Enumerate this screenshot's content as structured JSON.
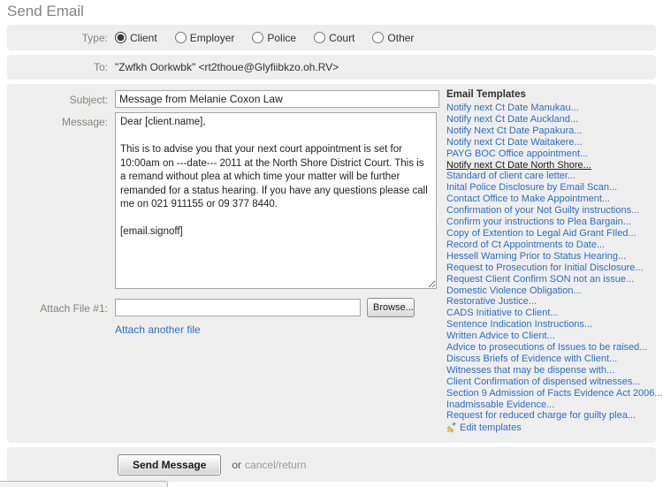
{
  "page": {
    "title": "Send Email"
  },
  "type_row": {
    "label": "Type:",
    "options": [
      {
        "label": "Client",
        "selected": true
      },
      {
        "label": "Employer",
        "selected": false
      },
      {
        "label": "Police",
        "selected": false
      },
      {
        "label": "Court",
        "selected": false
      },
      {
        "label": "Other",
        "selected": false
      }
    ]
  },
  "to_row": {
    "label": "To:",
    "value": "\"Zwfkh Oorkwbk\" <rt2thoue@Glyfiibkzo.oh.RV>"
  },
  "subject_row": {
    "label": "Subject:",
    "value": "Message from Melanie Coxon Law"
  },
  "message_row": {
    "label": "Message:",
    "value": "Dear [client.name],\n\nThis is to advise you that your next court appointment is set for 10:00am on ---date--- 2011 at the North Shore District Court. This is a remand without plea at which time your matter will be further remanded for a status hearing. If you have any questions please call me on 021 911155 or 09 377 8440.\n\n[email.signoff]"
  },
  "attach_row": {
    "label": "Attach File #1:",
    "value": "",
    "browse_label": "Browse...",
    "attach_another_label": "Attach another file"
  },
  "templates": {
    "heading": "Email Templates",
    "items": [
      {
        "label": "Notify next Ct Date Manukau...",
        "selected": false
      },
      {
        "label": "Notify next Ct Date Auckland...",
        "selected": false
      },
      {
        "label": "Notify Next Ct Date Papakura...",
        "selected": false
      },
      {
        "label": "Notify next Ct Date Waitakere...",
        "selected": false
      },
      {
        "label": "PAYG BOC Office appointment...",
        "selected": false
      },
      {
        "label": "Notify next Ct Date North Shore...",
        "selected": true
      },
      {
        "label": "Standard of client care letter...",
        "selected": false
      },
      {
        "label": "Inital Police Disclosure by Email Scan...",
        "selected": false
      },
      {
        "label": "Contact Office to Make Appointment...",
        "selected": false
      },
      {
        "label": "Confirmation of your Not Guilty instructions...",
        "selected": false
      },
      {
        "label": "Confirm your instructions to Plea Bargain...",
        "selected": false
      },
      {
        "label": "Copy of Extention to Legal Aid Grant FIled...",
        "selected": false
      },
      {
        "label": "Record of Ct Appointments to Date...",
        "selected": false
      },
      {
        "label": "Hessell Warning Prior to Status Hearing...",
        "selected": false
      },
      {
        "label": "Request to Prosecution for Initial Disclosure...",
        "selected": false
      },
      {
        "label": "Request Client Confirm SON not an issue...",
        "selected": false
      },
      {
        "label": "Domestic Violence Obligation...",
        "selected": false
      },
      {
        "label": "Restorative Justice...",
        "selected": false
      },
      {
        "label": "CADS Initiative to Client...",
        "selected": false
      },
      {
        "label": "Sentence Indication Instructions...",
        "selected": false
      },
      {
        "label": "Written Advice to Client...",
        "selected": false
      },
      {
        "label": "Advice to prosecutions of Issues to be raised...",
        "selected": false
      },
      {
        "label": "Discuss Briefs of Evidence with Client...",
        "selected": false
      },
      {
        "label": "Witnesses that may be dispense with...",
        "selected": false
      },
      {
        "label": "Client Confirmation of dispensed witnesses...",
        "selected": false
      },
      {
        "label": "Section 9 Admission of Facts Evidence Act 2006...",
        "selected": false
      },
      {
        "label": "Inadmissable Evidence...",
        "selected": false
      },
      {
        "label": "Request for reduced charge for guilty plea...",
        "selected": false
      }
    ],
    "edit_label": "Edit templates"
  },
  "footer": {
    "send_label": "Send Message",
    "or_label": "or",
    "cancel_label": "cancel/return"
  },
  "colors": {
    "panel_bg": "#eeeeee",
    "link_blue": "#2d6ec3",
    "label_gray": "#85857b",
    "pencil_yellow": "#e8c44a"
  }
}
